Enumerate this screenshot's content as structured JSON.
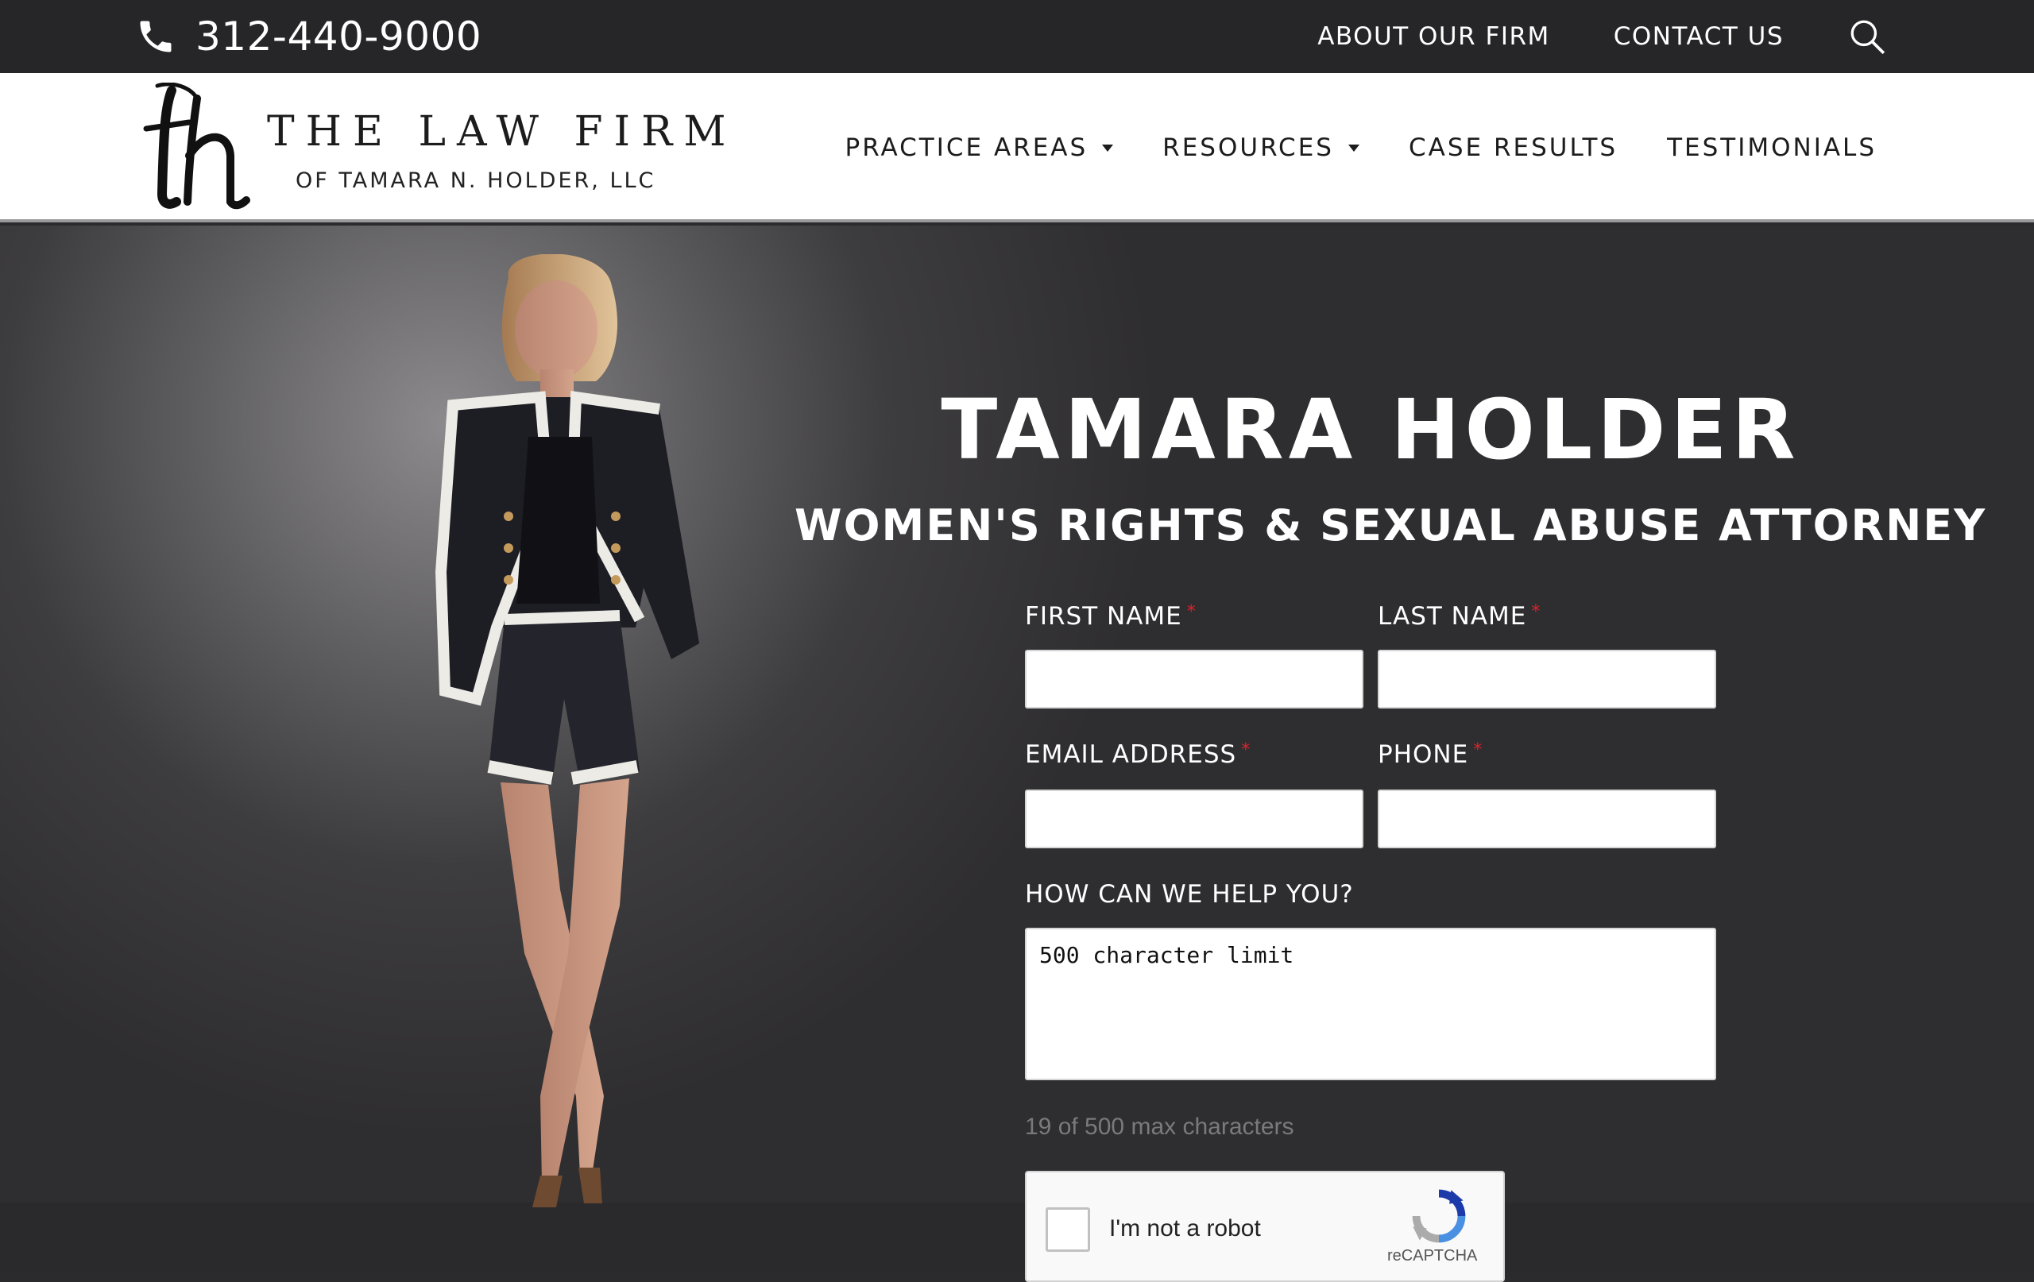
{
  "topbar": {
    "phone": "312-440-9000",
    "links": [
      "ABOUT OUR FIRM",
      "CONTACT US"
    ]
  },
  "header": {
    "logo_title": "THE LAW FIRM",
    "logo_subtitle": "OF TAMARA N. HOLDER, LLC",
    "nav": [
      "PRACTICE AREAS",
      "RESOURCES",
      "CASE RESULTS",
      "TESTIMONIALS"
    ]
  },
  "hero": {
    "title": "TAMARA HOLDER",
    "subtitle": "WOMEN'S RIGHTS & SEXUAL ABUSE ATTORNEY"
  },
  "form": {
    "first_name_label": "FIRST NAME",
    "last_name_label": "LAST NAME",
    "email_label": "EMAIL ADDRESS",
    "phone_label": "PHONE",
    "required_mark": "*",
    "message_label": "HOW CAN WE HELP YOU?",
    "message_value": "500 character limit",
    "counter": "19 of 500 max characters"
  },
  "captcha": {
    "label": "I'm not a robot",
    "brand": "reCAPTCHA"
  },
  "colors": {
    "topbar_bg": "#262628",
    "required": "#d9232d",
    "header_bg": "#ffffff"
  }
}
